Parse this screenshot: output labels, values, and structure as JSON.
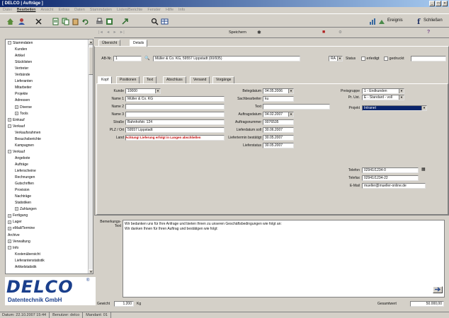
{
  "window": {
    "title": "[ DELCO | Aufträge ]",
    "min": "_",
    "max": "□",
    "close": "×"
  },
  "menu": [
    "Datei",
    "Bearbeiten",
    "Ansicht",
    "Extras",
    "Daten",
    "Stammdaten",
    "Listen/Berichte",
    "Fenster",
    "Hilfe",
    "Info"
  ],
  "toolbar": {
    "find_label": "Ereignis",
    "help_label": "Schließen"
  },
  "subtoolbar": {
    "search_label": "Speichern"
  },
  "sidebar": {
    "items": [
      {
        "label": "Stammdaten",
        "indent": 0,
        "box": "−"
      },
      {
        "label": "Kunden",
        "indent": 1,
        "box": ""
      },
      {
        "label": "Artikel",
        "indent": 1,
        "box": ""
      },
      {
        "label": "Stücklisten",
        "indent": 1,
        "box": ""
      },
      {
        "label": "Vertreter",
        "indent": 1,
        "box": ""
      },
      {
        "label": "Verbände",
        "indent": 1,
        "box": ""
      },
      {
        "label": "Lieferanten",
        "indent": 1,
        "box": ""
      },
      {
        "label": "Mitarbeiter",
        "indent": 1,
        "box": ""
      },
      {
        "label": "Projekte",
        "indent": 1,
        "box": ""
      },
      {
        "label": "Adressen",
        "indent": 1,
        "box": ""
      },
      {
        "label": "Diverse",
        "indent": 1,
        "box": "+"
      },
      {
        "label": "Tools",
        "indent": 1,
        "box": "+"
      },
      {
        "label": "Einkauf",
        "indent": 0,
        "box": "+"
      },
      {
        "label": "Verkauf",
        "indent": 0,
        "box": "−"
      },
      {
        "label": "Verkaufsrahmen",
        "indent": 1,
        "box": ""
      },
      {
        "label": "Besuchsberichte",
        "indent": 1,
        "box": ""
      },
      {
        "label": "Kampagnen",
        "indent": 1,
        "box": ""
      },
      {
        "label": "Verkauf",
        "indent": 0,
        "box": "−"
      },
      {
        "label": "Angebote",
        "indent": 1,
        "box": ""
      },
      {
        "label": "Aufträge",
        "indent": 1,
        "box": ""
      },
      {
        "label": "Lieferscheine",
        "indent": 1,
        "box": ""
      },
      {
        "label": "Rechnungen",
        "indent": 1,
        "box": ""
      },
      {
        "label": "Gutschriften",
        "indent": 1,
        "box": ""
      },
      {
        "label": "Provision",
        "indent": 1,
        "box": ""
      },
      {
        "label": "Nachträge",
        "indent": 1,
        "box": ""
      },
      {
        "label": "Statistiken",
        "indent": 1,
        "box": ""
      },
      {
        "label": "Zahlungen",
        "indent": 1,
        "box": "+"
      },
      {
        "label": "Fertigung",
        "indent": 0,
        "box": "+"
      },
      {
        "label": "Lager",
        "indent": 0,
        "box": "+"
      },
      {
        "label": "eMail/Termine",
        "indent": 0,
        "box": "+"
      },
      {
        "label": "Archive",
        "indent": 0,
        "box": ""
      },
      {
        "label": "Verwaltung",
        "indent": 0,
        "box": "+"
      },
      {
        "label": "Info",
        "indent": 0,
        "box": "−"
      },
      {
        "label": "Kostenübersicht",
        "indent": 1,
        "box": ""
      },
      {
        "label": "Lieferantenstatistik",
        "indent": 1,
        "box": ""
      },
      {
        "label": "Artikelstatistik",
        "indent": 1,
        "box": ""
      }
    ]
  },
  "logo": {
    "main": "DELCO",
    "sub": "Datentechnik GmbH",
    "reg": "®"
  },
  "statusbar": [
    "Datum: 22.10.2007  15:44",
    "Benutzer: delco",
    "Mandant: 01"
  ],
  "tabs_top": [
    {
      "label": "Übersicht"
    },
    {
      "label": "Details"
    }
  ],
  "record": {
    "label": "AB-Nr.",
    "value": "1",
    "customer": "Müller & Co. KG, 59557 Lippstadt (00/935)",
    "status_label": "Status",
    "status_value": "RA",
    "erledigt": "erledigt",
    "gedruckt": "gedruckt"
  },
  "tabs_form": [
    "Kopf",
    "Positionen",
    "Text",
    "Abschluss",
    "Versand",
    "Vorgänge"
  ],
  "form": {
    "left": [
      {
        "label": "Kunde",
        "value": "10000"
      },
      {
        "label": "Name 1",
        "value": "Müller & Co. KG"
      },
      {
        "label": "Name 2",
        "value": ""
      },
      {
        "label": "Name 3",
        "value": ""
      },
      {
        "label": "Straße",
        "value": "Bahnhofstr. 124"
      },
      {
        "label": "PLZ / Ort",
        "value": "59557 Lippstadt"
      },
      {
        "label": "Land",
        "value": ""
      }
    ],
    "warning": "Achtung! Lieferung erfolgt in Langen abschließen",
    "mid": [
      {
        "label": "Belegdatum",
        "value": "04.05.2006"
      },
      {
        "label": "Sachbearbeiter",
        "value": "ku"
      },
      {
        "label": "Text",
        "value": ""
      },
      {
        "label": "Auftragsdatum",
        "value": "04.02.2007"
      },
      {
        "label": "Auftragsnummer",
        "value": "0076535"
      },
      {
        "label": "Lieferdatum soll",
        "value": "30.06.2007"
      },
      {
        "label": "Liefertermin bestätigt",
        "value": "30.05.2007"
      },
      {
        "label": "Lieferstatus",
        "value": "30.05.2007"
      }
    ],
    "right": [
      {
        "label": "Preisgruppe",
        "value": "1 - Endkunden"
      },
      {
        "label": "Pr. Ust.",
        "value": "E - Standard - voll"
      },
      {
        "label": "Projekt",
        "value": "Intranet"
      }
    ],
    "right2": [
      {
        "label": "Telefon",
        "value": "02941/1234-0"
      },
      {
        "label": "Telefax",
        "value": "02941/1234-22"
      },
      {
        "label": "E-Mail",
        "value": "mueller@mueller-online.de"
      }
    ],
    "notes_label": "Bemerkungs-Text",
    "notes": [
      "Wir bedanken uns für Ihre Anfrage und bieten Ihnen zu unseren Geschäftsbedingungen wie folgt an:",
      "Wir danken Ihnen für Ihren Auftrag und bestätigen wie folgt:"
    ]
  },
  "footer": {
    "weight_label": "Gewicht",
    "weight_value": "1.200",
    "weight_unit": "Kg",
    "total_label": "Gesamtwert",
    "total_value": "50.000,00"
  }
}
